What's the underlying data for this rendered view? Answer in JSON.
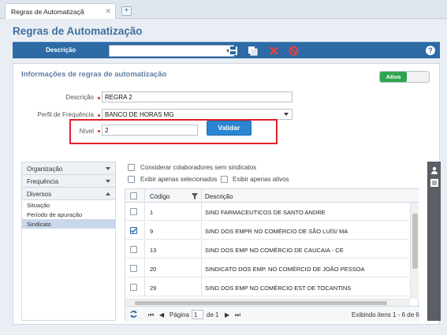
{
  "tab": {
    "title": "Regras de Automatizaçã",
    "close": "✕",
    "add": "+"
  },
  "page_title": "Regras de Automatização",
  "toolbar": {
    "label": "Descrição",
    "select_value": "",
    "icons": [
      "save-icon",
      "copy-icon",
      "delete-icon",
      "cancel-icon"
    ],
    "help": "?"
  },
  "section": {
    "title": "Informações de regras de automatização",
    "toggle_label": "Ativo"
  },
  "form": {
    "descricao_label": "Descrição",
    "descricao_value": "REGRA 2",
    "perfil_label": "Perfil de Frequência",
    "perfil_value": "BANCO DE HORAS MG",
    "nivel_label": "Nível",
    "nivel_value": "2",
    "validar_label": "Validar"
  },
  "side_menu": {
    "organizacao": "Organização",
    "frequencia": "Frequência",
    "diversos": "Diversos",
    "items": [
      "Situação",
      "Período de apuração",
      "Sindicato"
    ],
    "active_item": "Sindicato"
  },
  "options": {
    "sem_sindicatos": "Considerar colaboradores sem sindicatos",
    "selecionados": "Exibir apenas selecionados",
    "ativos": "Exibir apenas ativos"
  },
  "grid": {
    "col_codigo": "Código",
    "col_descricao": "Descrição",
    "rows": [
      {
        "codigo": "1",
        "descricao": "SIND FARMACEUTICOS DE SANTO ANDRE",
        "checked": false
      },
      {
        "codigo": "9",
        "descricao": "SIND DOS EMPR NO COMÉRCIO DE SÃO LUÍS/ MA",
        "checked": true
      },
      {
        "codigo": "13",
        "descricao": "SIND DOS EMP NO COMÉRCIO DE CAUCAIA - CE",
        "checked": false
      },
      {
        "codigo": "20",
        "descricao": "SINDICATO DOS EMP. NO COMÉRCIO DE JOÃO PESSOA",
        "checked": false
      },
      {
        "codigo": "29",
        "descricao": "SIND DOS EMP NO COMÉRCIO EST DE TOCANTINS",
        "checked": false
      }
    ]
  },
  "pager": {
    "page_label": "Página",
    "page_value": "1",
    "of_label": "de 1",
    "summary": "Exibindo itens 1 - 6 de 6"
  },
  "colors": {
    "brand_blue": "#2d6aa6",
    "title_blue": "#3f6f9f",
    "active_green": "#2ea44f",
    "highlight_red": "#e0202a"
  }
}
